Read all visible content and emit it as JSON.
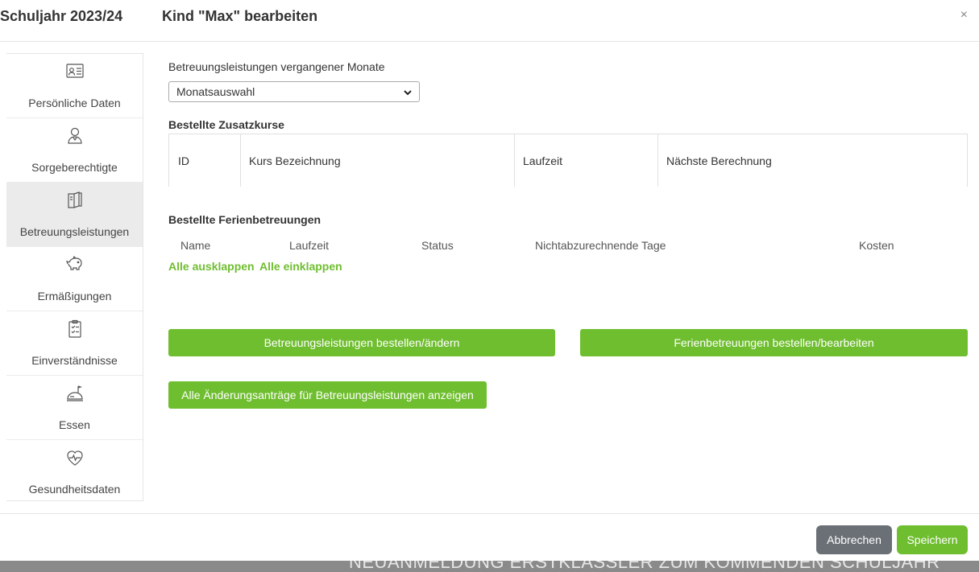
{
  "header": {
    "school_year": "Schuljahr 2023/24",
    "title": "Kind \"Max\" bearbeiten",
    "close_symbol": "×"
  },
  "sidebar": {
    "items": [
      {
        "label": "Persönliche Daten",
        "icon": "id-card-icon",
        "active": false
      },
      {
        "label": "Sorgeberechtigte",
        "icon": "person-icon",
        "active": false
      },
      {
        "label": "Betreuungsleistungen",
        "icon": "book-icon",
        "active": true
      },
      {
        "label": "Ermäßigungen",
        "icon": "piggy-bank-icon",
        "active": false
      },
      {
        "label": "Einverständnisse",
        "icon": "checklist-icon",
        "active": false
      },
      {
        "label": "Essen",
        "icon": "food-tray-icon",
        "active": false
      },
      {
        "label": "Gesundheitsdaten",
        "icon": "heart-pulse-icon",
        "active": false
      }
    ]
  },
  "main": {
    "past_months_label": "Betreuungsleistungen vergangener Monate",
    "month_select_value": "Monatsauswahl",
    "courses_heading": "Bestellte Zusatzkurse",
    "courses_columns": [
      "ID",
      "Kurs Bezeichnung",
      "Laufzeit",
      "Nächste Berechnung"
    ],
    "holiday_heading": "Bestellte Ferienbetreuungen",
    "holiday_columns": [
      "Name",
      "Laufzeit",
      "Status",
      "Nichtabzurechnende Tage",
      "Kosten"
    ],
    "expand_all": "Alle ausklappen",
    "collapse_all": "Alle einklappen",
    "btn_order_services": "Betreuungsleistungen bestellen/ändern",
    "btn_order_holiday": "Ferienbetreuungen bestellen/bearbeiten",
    "btn_show_requests": "Alle Änderungsanträge für Betreuungsleistungen anzeigen"
  },
  "footer": {
    "cancel": "Abbrechen",
    "save": "Speichern"
  },
  "background_text": "NEUANMELDUNG ERSTKLÄSSLER ZUM KOMMENDEN SCHULJAHR",
  "colors": {
    "accent_green": "#6fbe2f",
    "cancel_gray": "#6b7077",
    "active_item_bg": "#ebebeb"
  }
}
